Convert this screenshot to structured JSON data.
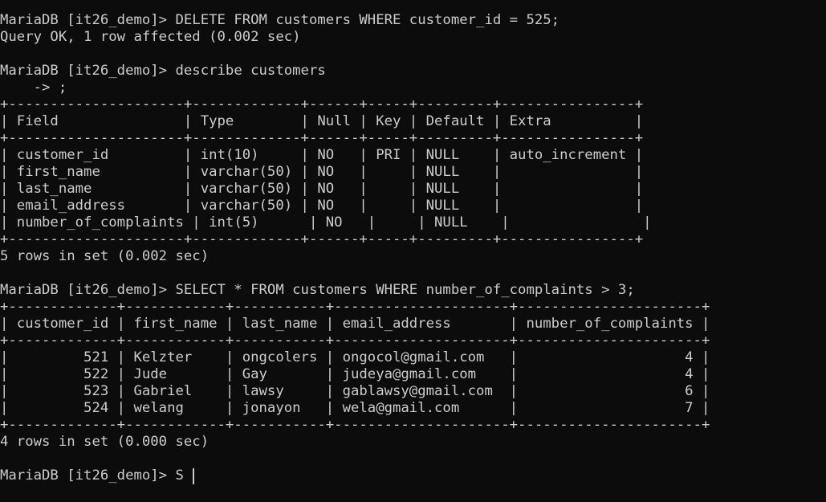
{
  "terminal": {
    "lines": [
      "MariaDB [it26_demo]> DELETE FROM customers WHERE customer_id = 525;",
      "Query OK, 1 row affected (0.002 sec)",
      "",
      "MariaDB [it26_demo]> describe customers",
      "    -> ;",
      "+---------------------+-------------+------+-----+---------+----------------+",
      "| Field               | Type        | Null | Key | Default | Extra          |",
      "+---------------------+-------------+------+-----+---------+----------------+",
      "| customer_id         | int(10)     | NO   | PRI | NULL    | auto_increment |",
      "| first_name          | varchar(50) | NO   |     | NULL    |                |",
      "| last_name           | varchar(50) | NO   |     | NULL    |                |",
      "| email_address       | varchar(50) | NO   |     | NULL    |                |",
      "| number_of_complaints | int(5)      | NO   |     | NULL    |                |",
      "+---------------------+-------------+------+-----+---------+----------------+",
      "5 rows in set (0.002 sec)",
      "",
      "MariaDB [it26_demo]> SELECT * FROM customers WHERE number_of_complaints > 3;",
      "+-------------+------------+-----------+---------------------+----------------------+",
      "| customer_id | first_name | last_name | email_address       | number_of_complaints |",
      "+-------------+------------+-----------+---------------------+----------------------+",
      "|         521 | Kelzter    | ongcolers | ongocol@gmail.com   |                    4 |",
      "|         522 | Jude       | Gay       | judeya@gmail.com    |                    4 |",
      "|         523 | Gabriel    | lawsy     | gablawsy@gmail.com  |                    6 |",
      "|         524 | welang     | jonayon   | wela@gmail.com      |                    7 |",
      "+-------------+------------+-----------+---------------------+----------------------+",
      "4 rows in set (0.000 sec)",
      "",
      "MariaDB [it26_demo]> S"
    ]
  }
}
